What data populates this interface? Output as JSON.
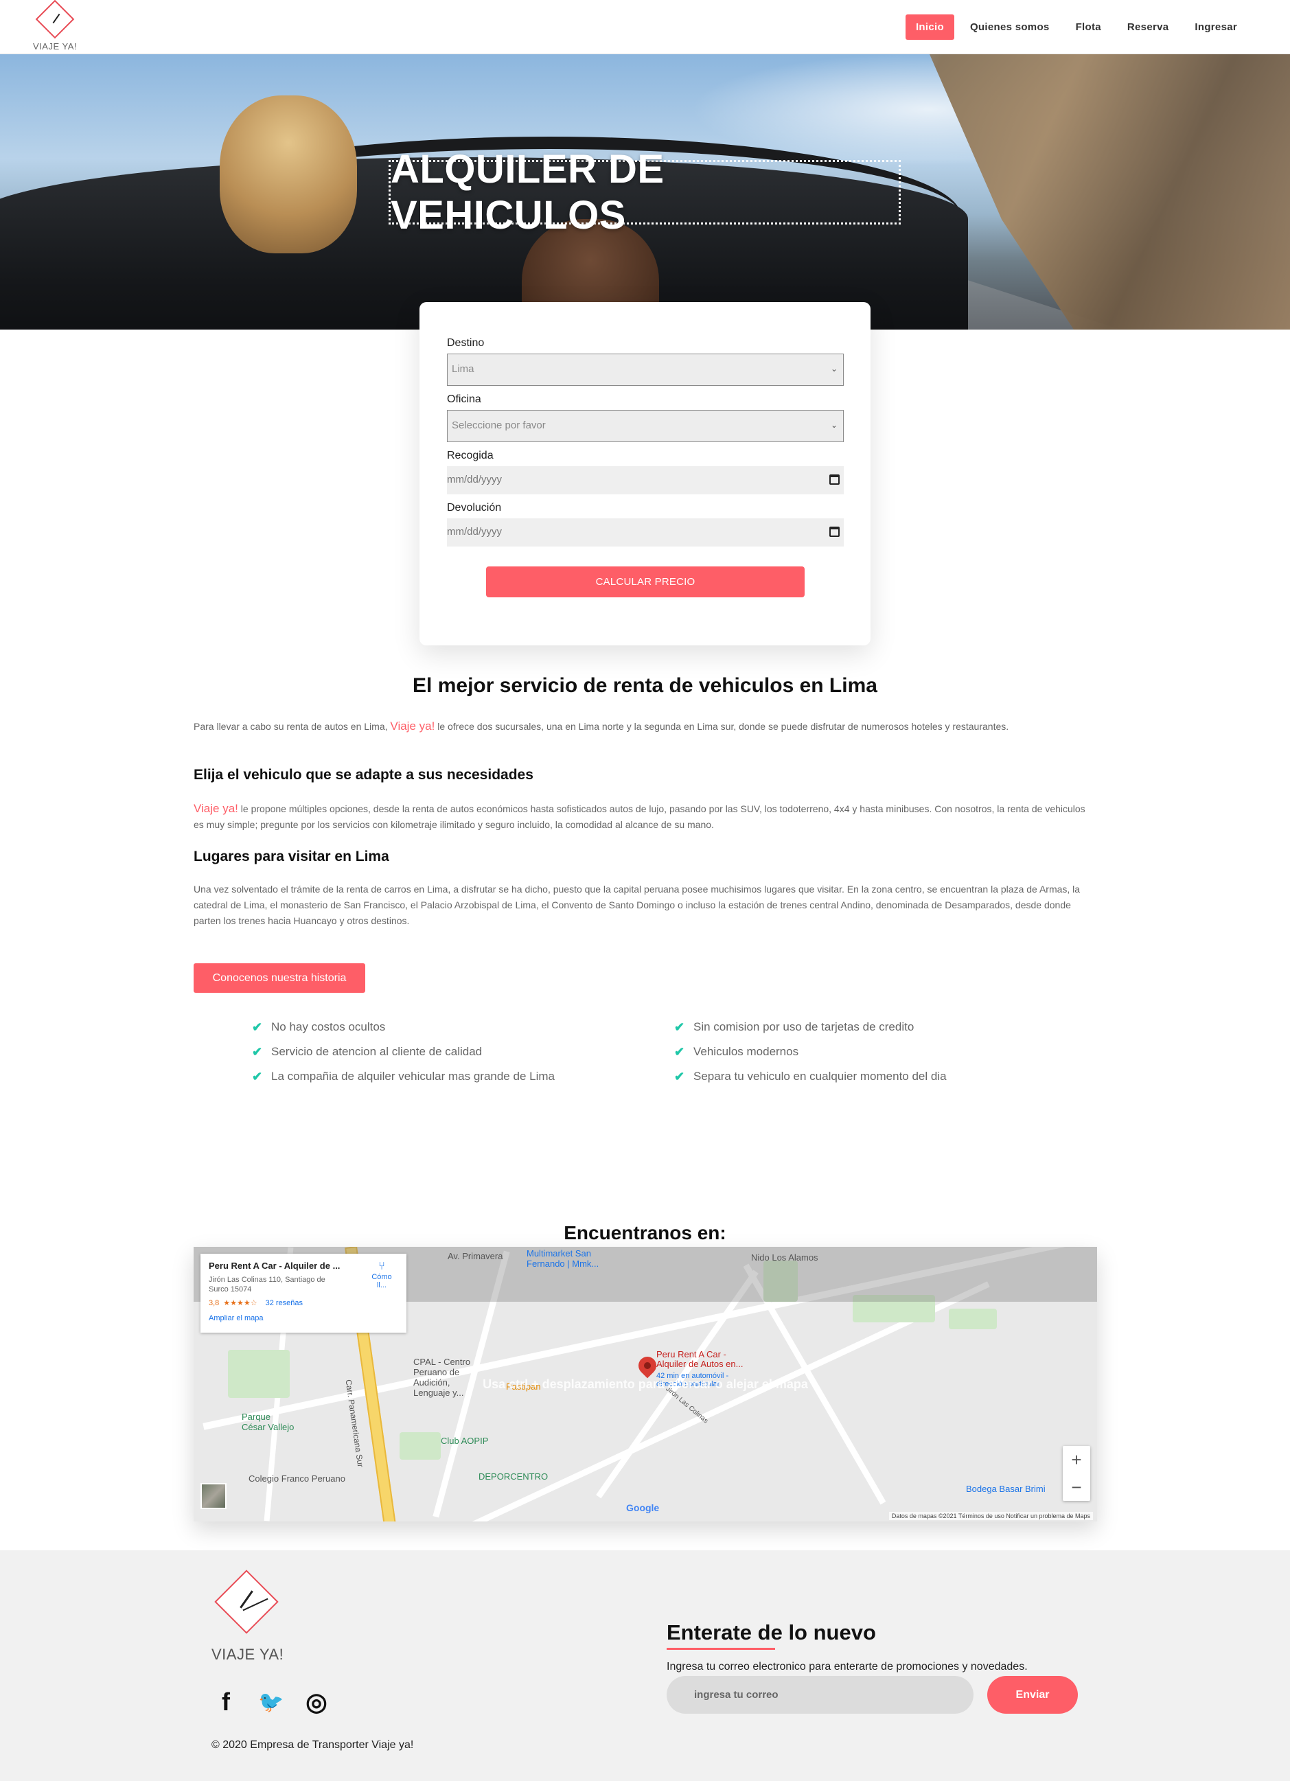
{
  "brand": {
    "name": "VIAJE YA!"
  },
  "nav": {
    "items": [
      {
        "label": "Inicio",
        "active": true
      },
      {
        "label": "Quienes somos"
      },
      {
        "label": "Flota"
      },
      {
        "label": "Reserva"
      },
      {
        "label": "Ingresar"
      }
    ]
  },
  "hero": {
    "title": "ALQUILER DE VEHICULOS"
  },
  "booking": {
    "destino_label": "Destino",
    "destino_value": "Lima",
    "oficina_label": "Oficina",
    "oficina_placeholder": "Seleccione por favor",
    "recogida_label": "Recogida",
    "recogida_placeholder": "mm/dd/yyyy",
    "devolucion_label": "Devolución",
    "devolucion_placeholder": "mm/dd/yyyy",
    "submit_label": "CALCULAR PRECIO"
  },
  "content": {
    "title": "El mejor servicio de renta de vehiculos en Lima",
    "p1_before": "Para llevar a cabo su renta de autos en Lima, ",
    "brand_inline": "Viaje ya!",
    "p1_after": " le ofrece dos sucursales, una en Lima norte y la segunda en Lima sur, donde se puede disfrutar de numerosos hoteles y restaurantes.",
    "h2": "Elija el vehiculo que se adapte a sus necesidades",
    "p2_after": " le propone múltiples opciones, desde la renta de autos económicos hasta sofisticados autos de lujo, pasando por las SUV, los todoterreno, 4x4 y hasta minibuses. Con nosotros, la renta de vehiculos es muy simple; pregunte por los servicios con kilometraje ilimitado y seguro incluido, la comodidad al alcance de su mano.",
    "h3": "Lugares para visitar en Lima",
    "p3": "Una vez solventado el trámite de la renta de carros en Lima, a disfrutar se ha dicho, puesto que la capital peruana posee muchisimos lugares que visitar. En la zona centro, se encuentran la plaza de Armas, la catedral de Lima, el monasterio de San Francisco, el Palacio Arzobispal de Lima, el Convento de Santo Domingo o incluso la estación de trenes central Andino, denominada de Desamparados, desde donde parten los trenes hacia Huancayo y otros destinos.",
    "story_button": "Conocenos nuestra historia"
  },
  "features": {
    "left": [
      "No hay costos ocultos",
      "Servicio de atencion al cliente de calidad",
      "La compañia de alquiler vehicular mas grande de Lima"
    ],
    "right": [
      "Sin comision por uso de tarjetas de credito",
      "Vehiculos modernos",
      "Separa tu vehiculo en cualquier momento del dia"
    ]
  },
  "map": {
    "title": "Encuentranos en:",
    "place_name": "Peru Rent A Car - Alquiler de ...",
    "address": "Jirón Las Colinas 110, Santiago de Surco 15074",
    "rating": "3,8",
    "stars": "★★★★☆",
    "reviews": "32 reseñas",
    "enlarge": "Ampliar el mapa",
    "directions": "Cómo ll...",
    "overlay": "Usa ctrl + desplazamiento para acercar o alejar el mapa",
    "pin_label": "Peru Rent A Car - Alquiler de Autos en...",
    "pin_sub": "42 min en automóvil - dirección particular",
    "labels": [
      "Av. Primavera",
      "Multimarket San Fernando | Mmk...",
      "Nido Los Alamos",
      "CPAL - Centro Peruano de Audición, Lenguaje y...",
      "Pastipan",
      "Parque César Vallejo",
      "Club AOPIP",
      "Colegio Franco Peruano",
      "DEPORCENTRO",
      "Bodega Basar Brimi",
      "Carr. Panamericana Sur",
      "Jirón Las Colinas"
    ],
    "zoom_in": "+",
    "zoom_out": "−",
    "attribution": "Datos de mapas ©2021   Términos de uso   Notificar un problema de Maps",
    "google": "Google"
  },
  "footer": {
    "logo_text": "VIAJE YA!",
    "news_title": "Enterate de lo nuevo",
    "news_text": "Ingresa tu correo electronico para enterarte de promociones y novedades.",
    "email_placeholder": "ingresa tu correo",
    "send_label": "Enviar",
    "copyright": "© 2020 Empresa de Transporter Viaje ya!",
    "social": [
      {
        "icon": "facebook-icon",
        "glyph": "f"
      },
      {
        "icon": "twitter-icon",
        "glyph": "🐦"
      },
      {
        "icon": "instagram-icon",
        "glyph": "◎"
      }
    ]
  },
  "colors": {
    "accent": "#fe5e67",
    "check": "#1fc7a8"
  }
}
